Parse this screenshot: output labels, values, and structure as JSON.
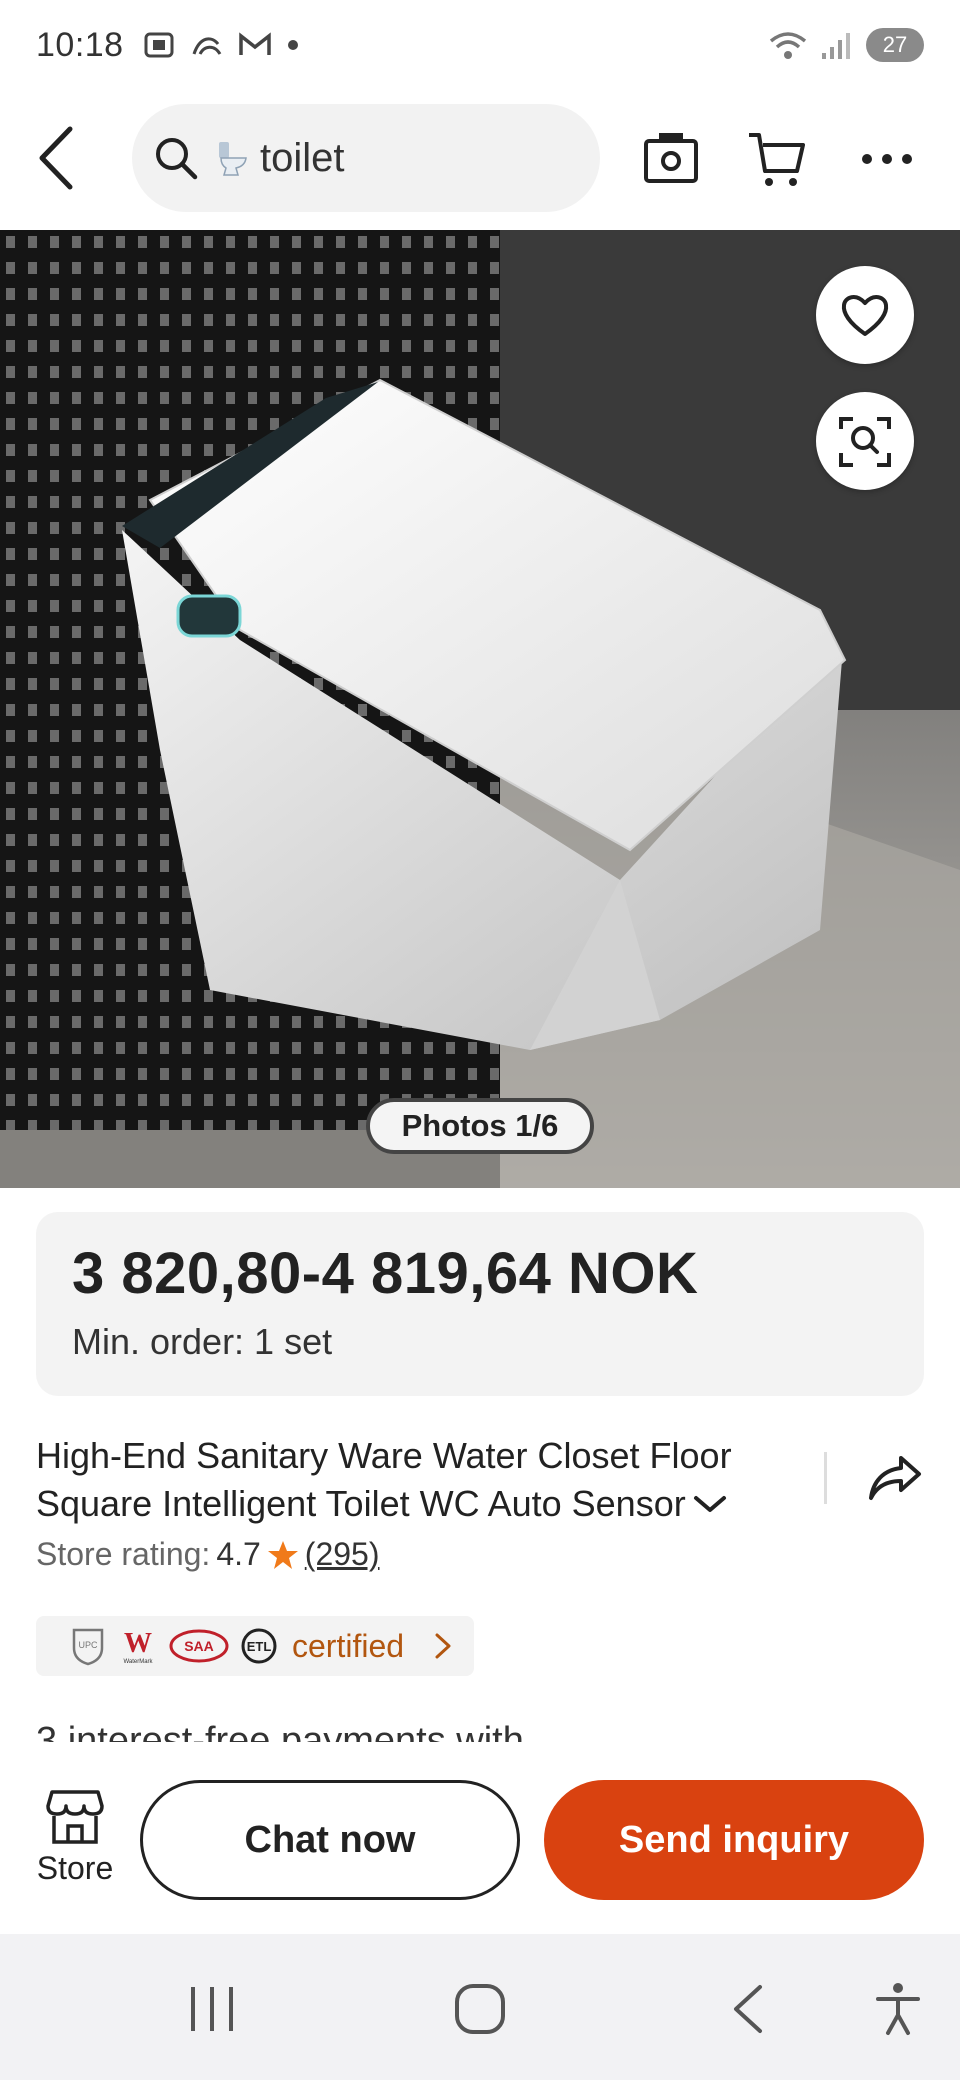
{
  "status_bar": {
    "time": "10:18",
    "battery": "27"
  },
  "search": {
    "query": "toilet"
  },
  "gallery": {
    "photos_indicator": "Photos 1/6"
  },
  "product": {
    "price_range": "3 820,80-4 819,64 NOK",
    "min_order": "Min. order: 1 set",
    "title_line1": "High-End Sanitary Ware Water Closet Floor",
    "title_line2": "Square Intelligent Toilet WC Auto Sensor",
    "store_rating_label": "Store rating:",
    "store_rating_value": "4.7",
    "review_count": "(295)",
    "certified_label": "certified",
    "cert_logos": [
      "UPC",
      "W",
      "SAA",
      "ETL"
    ],
    "payments_peek": "3 interest-free payments with"
  },
  "actions": {
    "store_label": "Store",
    "chat_label": "Chat now",
    "inquiry_label": "Send inquiry"
  },
  "colors": {
    "accent": "#d94210",
    "cert_text": "#b2560f",
    "star": "#f07a1a"
  },
  "icons": [
    "back-arrow-icon",
    "search-icon",
    "camera-search-icon",
    "cart-icon",
    "more-icon",
    "heart-icon",
    "visual-search-icon",
    "share-icon",
    "star-icon",
    "store-icon",
    "chevron-down-icon",
    "chevron-right-icon"
  ]
}
